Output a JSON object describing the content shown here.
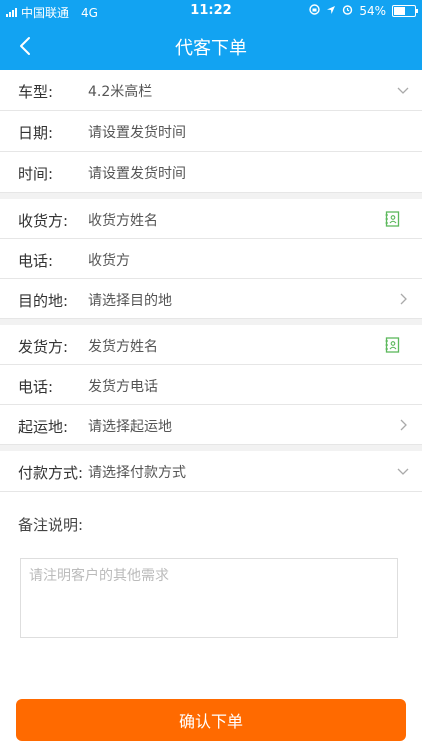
{
  "status_bar": {
    "carrier": "中国联通",
    "network": "4G",
    "time": "11:22",
    "battery": "54%"
  },
  "header": {
    "title": "代客下单",
    "back_icon": "chevron-left-icon"
  },
  "form": {
    "vehicle": {
      "label": "车型:",
      "value": "4.2米高栏"
    },
    "date": {
      "label": "日期:",
      "value": "请设置发货时间"
    },
    "time": {
      "label": "时间:",
      "value": "请设置发货时间"
    },
    "receiver": {
      "label": "收货方:",
      "placeholder": "收货方姓名"
    },
    "receiver_phone": {
      "label": "电话:",
      "placeholder": "收货方"
    },
    "destination": {
      "label": "目的地:",
      "value": "请选择目的地"
    },
    "sender": {
      "label": "发货方:",
      "placeholder": "发货方姓名"
    },
    "sender_phone": {
      "label": "电话:",
      "placeholder": "发货方电话"
    },
    "origin": {
      "label": "起运地:",
      "value": "请选择起运地"
    },
    "payment": {
      "label": "付款方式:",
      "value": "请选择付款方式"
    }
  },
  "remark": {
    "label": "备注说明:",
    "placeholder": "请注明客户的其他需求"
  },
  "confirm_button": "确认下单",
  "colors": {
    "header": "#12a3f2",
    "confirm": "#ff6a00",
    "contact_icon": "#5cb85c"
  }
}
